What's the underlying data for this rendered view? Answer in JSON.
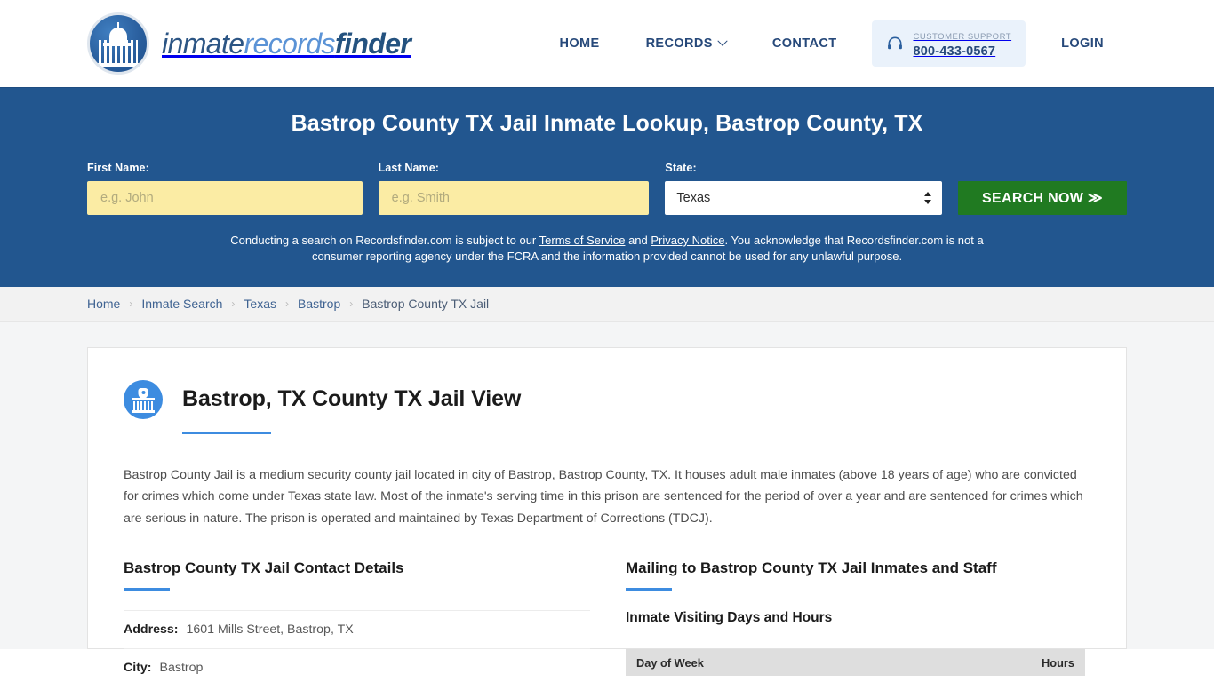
{
  "header": {
    "logo": {
      "part1": "inmate",
      "part2": "records",
      "part3": "finder",
      "icon": "capitol-dome-icon"
    },
    "nav": [
      {
        "label": "HOME",
        "name": "nav-home"
      },
      {
        "label": "RECORDS",
        "name": "nav-records",
        "has_caret": true
      },
      {
        "label": "CONTACT",
        "name": "nav-contact"
      }
    ],
    "support": {
      "label": "CUSTOMER SUPPORT",
      "phone": "800-433-0567",
      "icon": "headset-icon"
    },
    "login_label": "LOGIN"
  },
  "hero": {
    "title": "Bastrop County TX Jail Inmate Lookup, Bastrop County, TX",
    "first_name": {
      "label": "First Name:",
      "placeholder": "e.g. John",
      "value": ""
    },
    "last_name": {
      "label": "Last Name:",
      "placeholder": "e.g. Smith",
      "value": ""
    },
    "state": {
      "label": "State:",
      "selected": "Texas"
    },
    "search_button": "SEARCH NOW ≫",
    "disclaimer": {
      "part1": "Conducting a search on Recordsfinder.com is subject to our ",
      "link1": "Terms of Service",
      "part2": " and ",
      "link2": "Privacy Notice",
      "part3": ". You acknowledge that Recordsfinder.com is not a consumer reporting agency under the FCRA and the information provided cannot be used for any unlawful purpose."
    }
  },
  "breadcrumb": {
    "separator": "›",
    "items": [
      {
        "label": "Home",
        "name": "breadcrumb-home"
      },
      {
        "label": "Inmate Search",
        "name": "breadcrumb-inmate-search"
      },
      {
        "label": "Texas",
        "name": "breadcrumb-texas"
      },
      {
        "label": "Bastrop",
        "name": "breadcrumb-bastrop"
      },
      {
        "label": "Bastrop County TX Jail",
        "name": "breadcrumb-current"
      }
    ]
  },
  "main": {
    "title": "Bastrop, TX County TX Jail View",
    "title_icon": "jail-building-icon",
    "description": "Bastrop County Jail is a medium security county jail located in city of Bastrop, Bastrop County, TX. It houses adult male inmates (above 18 years of age) who are convicted for crimes which come under Texas state law. Most of the inmate's serving time in this prison are sentenced for the period of over a year and are sentenced for crimes which are serious in nature. The prison is operated and maintained by Texas Department of Corrections (TDCJ).",
    "left": {
      "heading": "Bastrop County TX Jail Contact Details",
      "rows": [
        {
          "key": "Address:",
          "value": "1601 Mills Street, Bastrop, TX"
        },
        {
          "key": "City:",
          "value": "Bastrop"
        }
      ]
    },
    "right": {
      "heading": "Mailing to Bastrop County TX Jail Inmates and Staff",
      "sub_heading": "Inmate Visiting Days and Hours",
      "table": {
        "columns": [
          "Day of Week",
          "Hours"
        ],
        "rows": []
      }
    }
  },
  "colors": {
    "hero_blue": "#22568f",
    "accent_blue": "#3d8ce0",
    "green_button": "#207a21",
    "input_yellow": "#fbeca4",
    "table_header_gray": "#dedede"
  }
}
